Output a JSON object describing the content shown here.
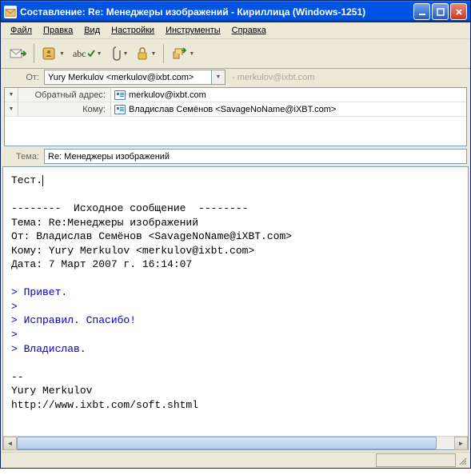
{
  "titlebar": {
    "text": "Составление: Re: Менеджеры изображений - Кириллица (Windows-1251)"
  },
  "menubar": {
    "file": "Файл",
    "edit": "Правка",
    "view": "Вид",
    "settings": "Настройки",
    "tools": "Инструменты",
    "help": "Справка"
  },
  "from": {
    "label": "От:",
    "value": "Yury Merkulov <merkulov@ixbt.com>",
    "extra": "- merkulov@ixbt.com"
  },
  "addr": {
    "reply": {
      "label": "Обратный адрес:",
      "value": "merkulov@ixbt.com"
    },
    "to": {
      "label": "Кому:",
      "value": "Владислав Семёнов <SavageNoName@iXBT.com>"
    }
  },
  "subject": {
    "label": "Тема:",
    "value": "Re: Менеджеры изображений"
  },
  "body": {
    "typed": "Тест.",
    "sep": "--------  Исходное сообщение  --------",
    "h_subject": "Тема: Re:Менеджеры изображений",
    "h_from": "От: Владислав Семёнов <SavageNoName@iXBT.com>",
    "h_to": "Кому: Yury Merkulov <merkulov@ixbt.com>",
    "h_date": "Дата: 7 Март 2007 г. 16:14:07",
    "q1": "> Привет.",
    "q2": ">",
    "q3": "> Исправил. Спасибо!",
    "q4": ">",
    "q5": "> Владислав.",
    "sig1": "--",
    "sig2": "Yury Merkulov",
    "sig3": "http://www.ixbt.com/soft.shtml"
  }
}
